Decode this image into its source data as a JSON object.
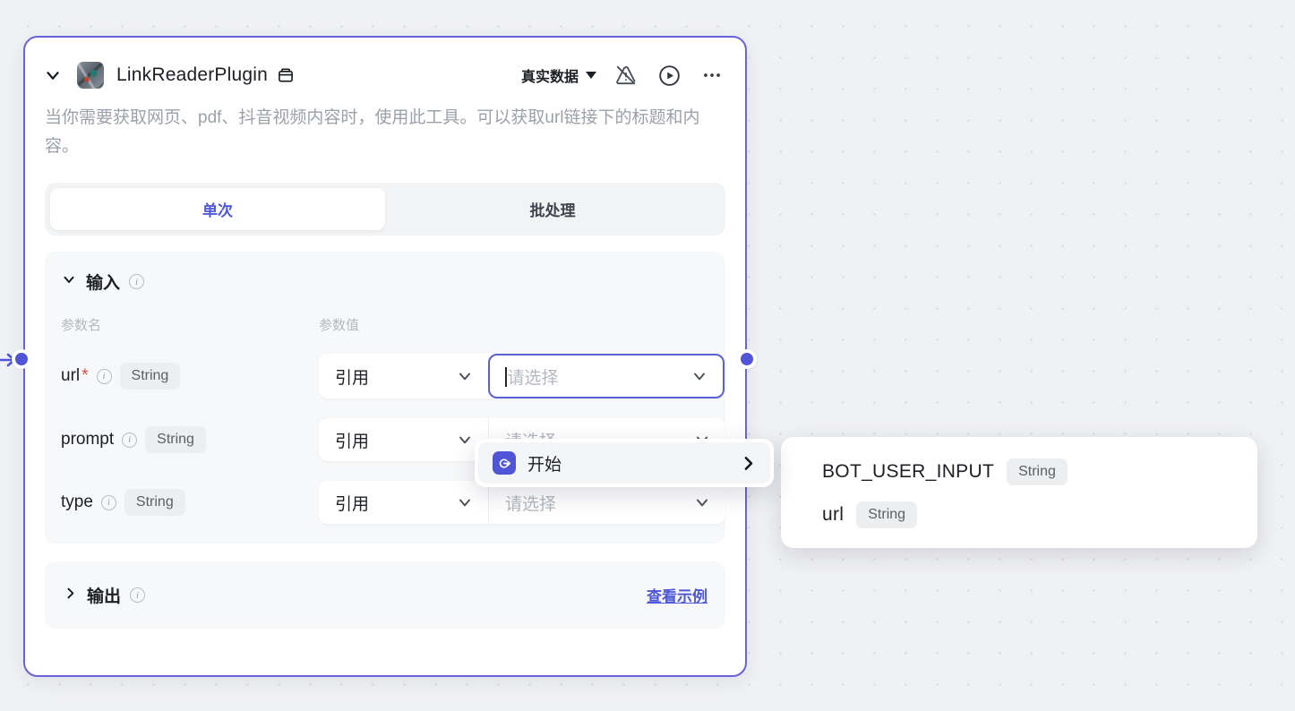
{
  "node": {
    "title": "LinkReaderPlugin",
    "title_icon": "plugin-box-icon",
    "collapse_icon": "chevron-down-icon",
    "avatar_icon": "plugin-avatar-image",
    "description": "当你需要获取网页、pdf、抖音视频内容时，使用此工具。可以获取url链接下的标题和内容。",
    "data_mode_label": "真实数据",
    "data_mode_caret": "chevron-down-icon",
    "warning_icon": "warning-slash-icon",
    "run_icon": "play-circle-icon",
    "more_icon": "more-dots-icon"
  },
  "tabs": [
    {
      "label": "单次",
      "active": true
    },
    {
      "label": "批处理",
      "active": false
    }
  ],
  "input_section": {
    "title": "输入",
    "chevron": "chevron-down-icon",
    "info_icon": "info-icon",
    "col_name": "参数名",
    "col_value": "参数值",
    "rows": [
      {
        "name": "url",
        "required": true,
        "required_marker": "*",
        "type": "String",
        "mode": "引用",
        "value_placeholder": "请选择",
        "focused": true
      },
      {
        "name": "prompt",
        "required": false,
        "required_marker": "",
        "type": "String",
        "mode": "引用",
        "value_placeholder": "请选择",
        "focused": false
      },
      {
        "name": "type",
        "required": false,
        "required_marker": "",
        "type": "String",
        "mode": "引用",
        "value_placeholder": "请选择",
        "focused": false
      }
    ]
  },
  "output_section": {
    "title": "输出",
    "chevron": "chevron-right-icon",
    "info_icon": "info-icon",
    "view_example": "查看示例"
  },
  "dropdown": {
    "items": [
      {
        "label": "开始",
        "icon": "start-node-icon",
        "arrow": "chevron-right-icon",
        "highlighted": true
      }
    ]
  },
  "submenu": {
    "rows": [
      {
        "name": "BOT_USER_INPUT",
        "type": "String"
      },
      {
        "name": "url",
        "type": "String"
      }
    ]
  },
  "ports": {
    "input_port": "input-connection-port",
    "output_port": "output-connection-port",
    "incoming_arrow": "incoming-edge-arrow"
  },
  "colors": {
    "accent": "#4f55d6",
    "card_border": "#6a62d8",
    "canvas_bg": "#f0f1f4",
    "required_star": "#e8493f",
    "muted_text": "#9ca1a9"
  }
}
